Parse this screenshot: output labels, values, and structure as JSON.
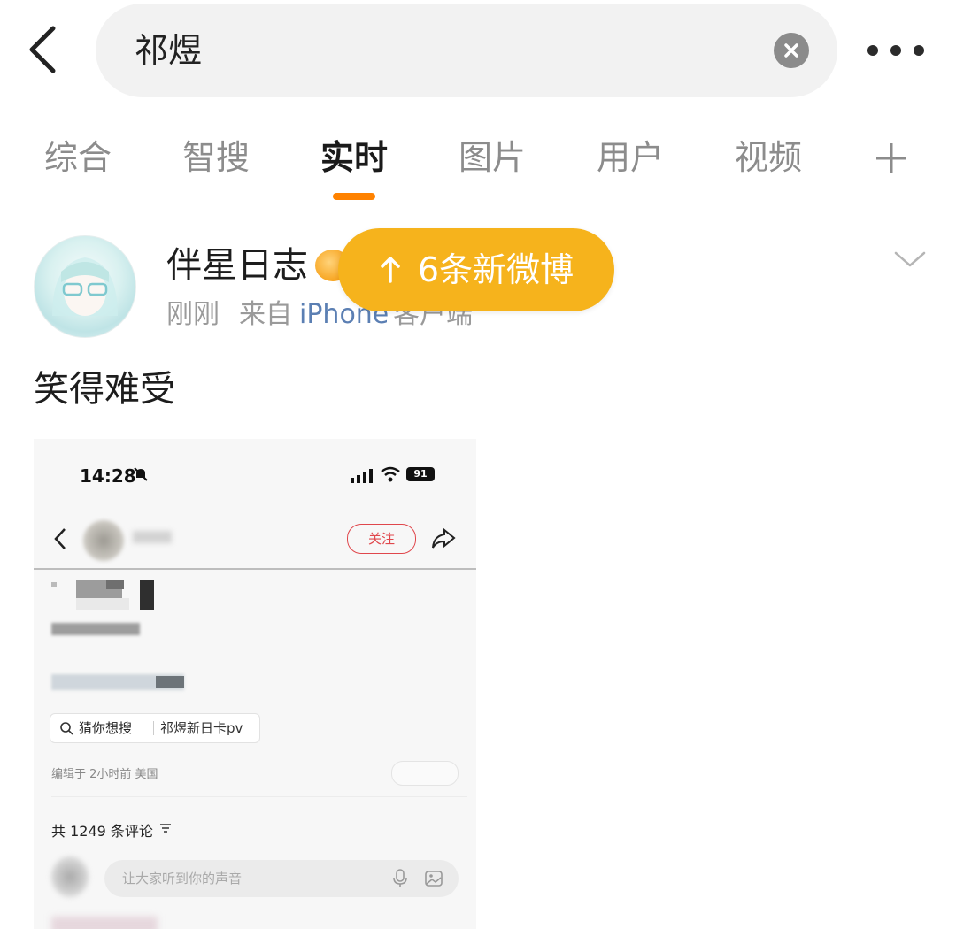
{
  "search": {
    "query": "祁煜"
  },
  "tabs": [
    {
      "label": "综合",
      "active": false
    },
    {
      "label": "智搜",
      "active": false
    },
    {
      "label": "实时",
      "active": true
    },
    {
      "label": "图片",
      "active": false
    },
    {
      "label": "用户",
      "active": false
    },
    {
      "label": "视频",
      "active": false
    }
  ],
  "accent_color": "#ff8200",
  "post": {
    "author": "伴星日志",
    "time": "刚刚",
    "source_prefix": "来自",
    "source_link": "iPhone",
    "source_suffix": "客户端",
    "text": "笑得难受"
  },
  "new_posts_pill": {
    "label": "6条新微博",
    "color": "#f6b31c"
  },
  "embedded_screenshot": {
    "status_time": "14:28",
    "battery": "91",
    "follow_label": "关注",
    "suggest_label": "猜你想搜",
    "suggest_term": "祁煜新日卡pv",
    "edit_info": "编辑于 2小时前 美国",
    "comment_count": "共 1249 条评论",
    "comment_placeholder": "让大家听到你的声音"
  },
  "icons": {
    "back": "chevron-left-icon",
    "clear": "clear-icon",
    "more": "more-horizontal-icon",
    "plus": "plus-icon",
    "collapse": "chevron-down-icon",
    "arrow_up": "arrow-up-icon"
  }
}
